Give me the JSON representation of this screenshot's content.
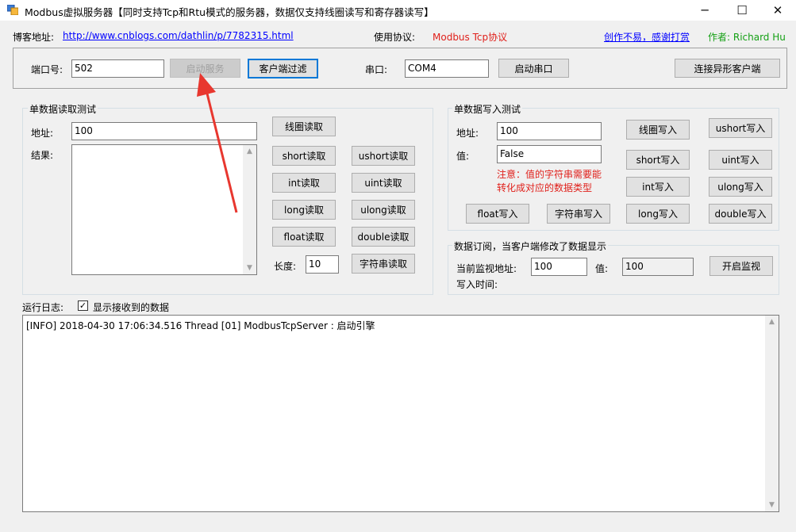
{
  "window": {
    "title": "Modbus虚拟服务器【同时支持Tcp和Rtu模式的服务器，数据仅支持线圈读写和寄存器读写】",
    "minimize": "─",
    "maximize": "☐",
    "close": "✕"
  },
  "header": {
    "blog_label": "博客地址:",
    "blog_url": "http://www.cnblogs.com/dathlin/p/7782315.html",
    "protocol_label": "使用协议:",
    "protocol_value": "Modbus Tcp协议",
    "donate_link": "创作不易，感谢打赏",
    "author": "作者: Richard Hu"
  },
  "server": {
    "port_label": "端口号:",
    "port_value": "502",
    "start_button": "启动服务",
    "client_filter_button": "客户端过滤",
    "serial_label": "串口:",
    "serial_value": "COM4",
    "start_serial_button": "启动串口",
    "connect_alien_button": "连接异形客户端"
  },
  "read_test": {
    "title": "单数据读取测试",
    "address_label": "地址:",
    "address_value": "100",
    "result_label": "结果:",
    "length_label": "长度:",
    "length_value": "10",
    "buttons": {
      "coil": "线圈读取",
      "short": "short读取",
      "ushort": "ushort读取",
      "int": "int读取",
      "uint": "uint读取",
      "long": "long读取",
      "ulong": "ulong读取",
      "float": "float读取",
      "double": "double读取",
      "string": "字符串读取"
    }
  },
  "write_test": {
    "title": "单数据写入测试",
    "address_label": "地址:",
    "address_value": "100",
    "value_label": "值:",
    "value_value": "False",
    "note_line1": "注意：值的字符串需要能",
    "note_line2": "转化成对应的数据类型",
    "buttons": {
      "coil": "线圈写入",
      "ushort": "ushort写入",
      "short": "short写入",
      "uint": "uint写入",
      "int": "int写入",
      "ulong": "ulong写入",
      "float": "float写入",
      "string": "字符串写入",
      "long": "long写入",
      "double": "double写入"
    }
  },
  "subscribe": {
    "title": "数据订阅，当客户端修改了数据显示",
    "monitor_address_label": "当前监视地址:",
    "monitor_address_value": "100",
    "value_label": "值:",
    "value_value": "100",
    "start_button": "开启监视",
    "write_time_label": "写入时间:"
  },
  "log": {
    "label": "运行日志:",
    "checkbox_label": "显示接收到的数据",
    "checkbox_checked": true,
    "lines": [
      "[INFO] 2018-04-30 17:06:34.516 Thread [01] ModbusTcpServer : 启动引擎"
    ]
  },
  "colors": {
    "link": "#0000ff",
    "protocol": "#e0201b",
    "author": "#14a014",
    "annotation_arrow": "#e8372f"
  }
}
